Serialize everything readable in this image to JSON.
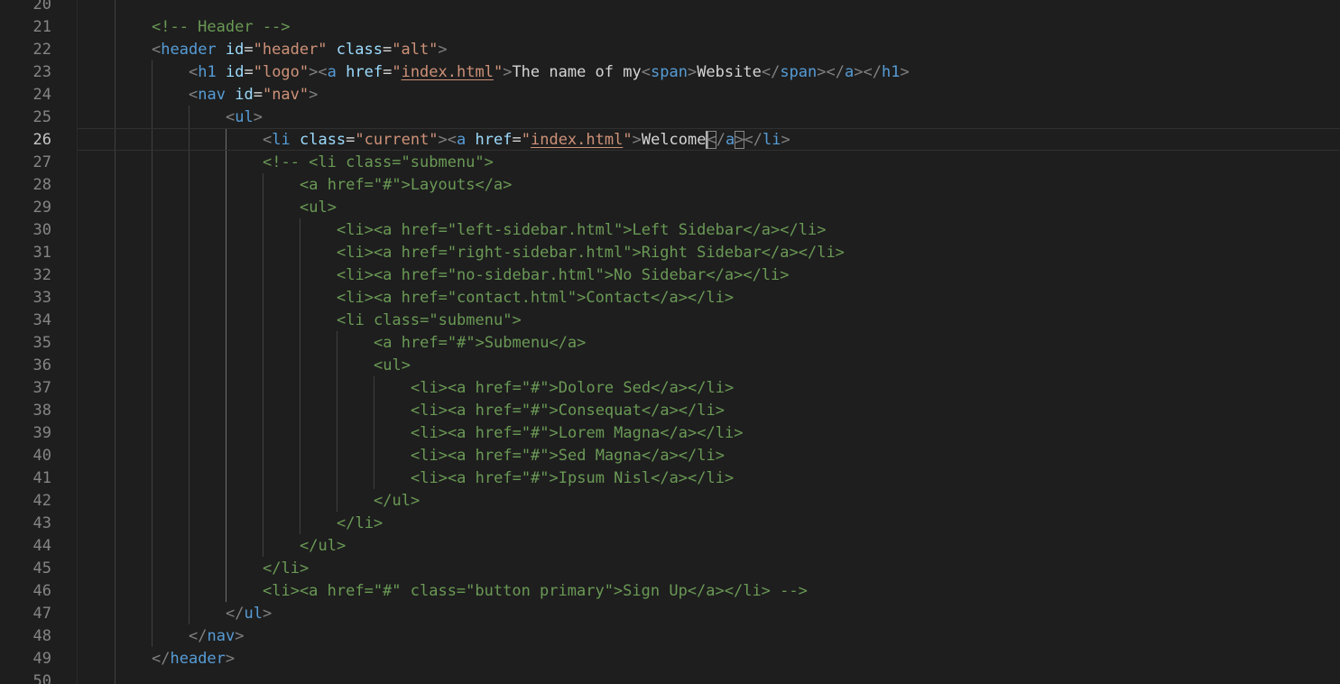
{
  "editor": {
    "language": "html",
    "theme_colors": {
      "background": "#1e1e1e",
      "tag": "#569cd6",
      "attribute": "#9cdcfe",
      "string": "#ce9178",
      "comment": "#6a9955",
      "text": "#d4d4d4",
      "line_number": "#858585"
    },
    "active_line": 26,
    "lines": [
      {
        "num": "20"
      },
      {
        "num": "21",
        "tokens": [
          [
            "c",
            "<!-- Header -->"
          ]
        ]
      },
      {
        "num": "22",
        "tokens": [
          [
            "p",
            "<"
          ],
          [
            "t",
            "header"
          ],
          [
            "x",
            " "
          ],
          [
            "a",
            "id"
          ],
          [
            "x",
            "="
          ],
          [
            "s",
            "\"header\""
          ],
          [
            "x",
            " "
          ],
          [
            "a",
            "class"
          ],
          [
            "x",
            "="
          ],
          [
            "s",
            "\"alt\""
          ],
          [
            "p",
            ">"
          ]
        ]
      },
      {
        "num": "23",
        "tokens": [
          [
            "p",
            "<"
          ],
          [
            "t",
            "h1"
          ],
          [
            "x",
            " "
          ],
          [
            "a",
            "id"
          ],
          [
            "x",
            "="
          ],
          [
            "s",
            "\"logo\""
          ],
          [
            "p",
            "><"
          ],
          [
            "t",
            "a"
          ],
          [
            "x",
            " "
          ],
          [
            "a",
            "href"
          ],
          [
            "x",
            "="
          ],
          [
            "s",
            "\""
          ],
          [
            "u",
            "index.html"
          ],
          [
            "s",
            "\""
          ],
          [
            "p",
            ">"
          ],
          [
            "x",
            "The name of my"
          ],
          [
            "p",
            "<"
          ],
          [
            "t",
            "span"
          ],
          [
            "p",
            ">"
          ],
          [
            "x",
            "Website"
          ],
          [
            "p",
            "</"
          ],
          [
            "t",
            "span"
          ],
          [
            "p",
            "></"
          ],
          [
            "t",
            "a"
          ],
          [
            "p",
            "></"
          ],
          [
            "t",
            "h1"
          ],
          [
            "p",
            ">"
          ]
        ]
      },
      {
        "num": "24",
        "tokens": [
          [
            "p",
            "<"
          ],
          [
            "t",
            "nav"
          ],
          [
            "x",
            " "
          ],
          [
            "a",
            "id"
          ],
          [
            "x",
            "="
          ],
          [
            "s",
            "\"nav\""
          ],
          [
            "p",
            ">"
          ]
        ]
      },
      {
        "num": "25",
        "tokens": [
          [
            "p",
            "<"
          ],
          [
            "t",
            "ul"
          ],
          [
            "p",
            ">"
          ]
        ]
      },
      {
        "num": "26",
        "tokens": [
          [
            "p",
            "<"
          ],
          [
            "t",
            "li"
          ],
          [
            "x",
            " "
          ],
          [
            "a",
            "class"
          ],
          [
            "x",
            "="
          ],
          [
            "s",
            "\"current\""
          ],
          [
            "p",
            "><"
          ],
          [
            "t",
            "a"
          ],
          [
            "x",
            " "
          ],
          [
            "a",
            "href"
          ],
          [
            "x",
            "="
          ],
          [
            "s",
            "\""
          ],
          [
            "u",
            "index.html"
          ],
          [
            "s",
            "\""
          ],
          [
            "p",
            ">"
          ],
          [
            "x",
            "Welcome"
          ],
          [
            "cursor",
            ""
          ],
          [
            "bmp",
            "<"
          ],
          [
            "p",
            "/"
          ],
          [
            "t",
            "a"
          ],
          [
            "bmp",
            ">"
          ],
          [
            "p",
            "</"
          ],
          [
            "t",
            "li"
          ],
          [
            "p",
            ">"
          ]
        ]
      },
      {
        "num": "27",
        "tokens": [
          [
            "c",
            "<!-- <li class=\"submenu\">"
          ]
        ]
      },
      {
        "num": "28",
        "tokens": [
          [
            "c",
            "<a href=\"#\">Layouts</a>"
          ]
        ]
      },
      {
        "num": "29",
        "tokens": [
          [
            "c",
            "<ul>"
          ]
        ]
      },
      {
        "num": "30",
        "tokens": [
          [
            "c",
            "<li><a href=\"left-sidebar.html\">Left Sidebar</a></li>"
          ]
        ]
      },
      {
        "num": "31",
        "tokens": [
          [
            "c",
            "<li><a href=\"right-sidebar.html\">Right Sidebar</a></li>"
          ]
        ]
      },
      {
        "num": "32",
        "tokens": [
          [
            "c",
            "<li><a href=\"no-sidebar.html\">No Sidebar</a></li>"
          ]
        ]
      },
      {
        "num": "33",
        "tokens": [
          [
            "c",
            "<li><a href=\"contact.html\">Contact</a></li>"
          ]
        ]
      },
      {
        "num": "34",
        "tokens": [
          [
            "c",
            "<li class=\"submenu\">"
          ]
        ]
      },
      {
        "num": "35",
        "tokens": [
          [
            "c",
            "<a href=\"#\">Submenu</a>"
          ]
        ]
      },
      {
        "num": "36",
        "tokens": [
          [
            "c",
            "<ul>"
          ]
        ]
      },
      {
        "num": "37",
        "tokens": [
          [
            "c",
            "<li><a href=\"#\">Dolore Sed</a></li>"
          ]
        ]
      },
      {
        "num": "38",
        "tokens": [
          [
            "c",
            "<li><a href=\"#\">Consequat</a></li>"
          ]
        ]
      },
      {
        "num": "39",
        "tokens": [
          [
            "c",
            "<li><a href=\"#\">Lorem Magna</a></li>"
          ]
        ]
      },
      {
        "num": "40",
        "tokens": [
          [
            "c",
            "<li><a href=\"#\">Sed Magna</a></li>"
          ]
        ]
      },
      {
        "num": "41",
        "tokens": [
          [
            "c",
            "<li><a href=\"#\">Ipsum Nisl</a></li>"
          ]
        ]
      },
      {
        "num": "42",
        "tokens": [
          [
            "c",
            "</ul>"
          ]
        ]
      },
      {
        "num": "43",
        "tokens": [
          [
            "c",
            "</li>"
          ]
        ]
      },
      {
        "num": "44",
        "tokens": [
          [
            "c",
            "</ul>"
          ]
        ]
      },
      {
        "num": "45",
        "tokens": [
          [
            "c",
            "</li>"
          ]
        ]
      },
      {
        "num": "46",
        "tokens": [
          [
            "c",
            "<li><a href=\"#\" class=\"button primary\">Sign Up</a></li> -->"
          ]
        ]
      },
      {
        "num": "47",
        "tokens": [
          [
            "p",
            "</"
          ],
          [
            "t",
            "ul"
          ],
          [
            "p",
            ">"
          ]
        ]
      },
      {
        "num": "48",
        "tokens": [
          [
            "p",
            "</"
          ],
          [
            "t",
            "nav"
          ],
          [
            "p",
            ">"
          ]
        ]
      },
      {
        "num": "49",
        "tokens": [
          [
            "p",
            "</"
          ],
          [
            "t",
            "header"
          ],
          [
            "p",
            ">"
          ]
        ]
      },
      {
        "num": "50"
      }
    ]
  }
}
